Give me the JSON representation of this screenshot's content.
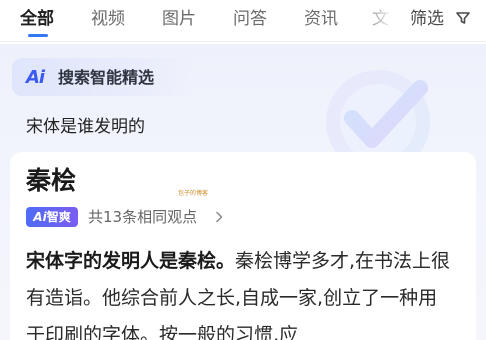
{
  "tabs": {
    "items": [
      {
        "label": "全部",
        "active": true
      },
      {
        "label": "视频",
        "active": false
      },
      {
        "label": "图片",
        "active": false
      },
      {
        "label": "问答",
        "active": false
      },
      {
        "label": "资讯",
        "active": false
      },
      {
        "label": "文",
        "active": false
      }
    ],
    "filter_label": "筛选",
    "accent_color": "#3478f6"
  },
  "ai_card": {
    "logo": "Ai",
    "title": "搜索智能精选",
    "query": "宋体是谁发明的",
    "accent_color": "#3b5bf0"
  },
  "answer": {
    "title": "秦桧",
    "watermark": "包子的博客",
    "source_tag": {
      "ai": "Ai",
      "text": "智爽"
    },
    "source_count": "共13条相同观点",
    "body": {
      "highlight": "宋体字的发明人是秦桧。",
      "rest": "秦桧博学多才,在书法上很有造诣。他综合前人之长,自成一家,创立了一种用于印刷的字体。按一般的习惯,应"
    }
  }
}
